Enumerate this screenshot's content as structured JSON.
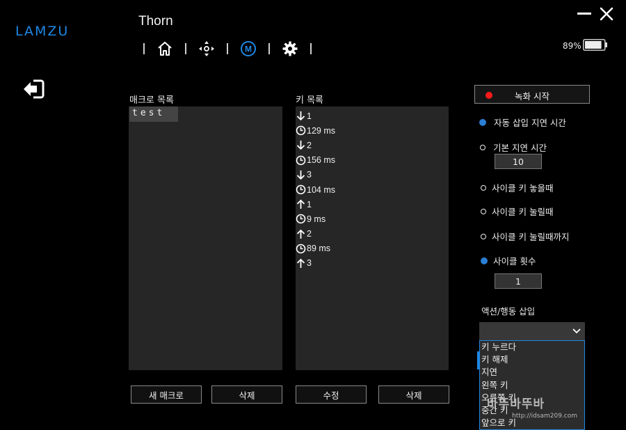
{
  "app": {
    "logo": "LAMZU",
    "device_name": "Thorn",
    "battery_percent": "89%",
    "battery_level": 0.89
  },
  "nav": {
    "items": [
      {
        "icon": "home-icon"
      },
      {
        "icon": "dpad-icon"
      },
      {
        "icon": "macro-icon",
        "text": "M",
        "active": true
      },
      {
        "icon": "gear-icon"
      }
    ]
  },
  "macro_list": {
    "label": "매크로 목록",
    "items": [
      "test"
    ],
    "new_button": "새 매크로",
    "delete_button": "삭제"
  },
  "key_list": {
    "label": "키 목록",
    "rows": [
      {
        "icon": "arrow-down-icon",
        "text": "1"
      },
      {
        "icon": "clock-icon",
        "text": "129 ms"
      },
      {
        "icon": "arrow-down-icon",
        "text": "2"
      },
      {
        "icon": "clock-icon",
        "text": "156 ms"
      },
      {
        "icon": "arrow-down-icon",
        "text": "3"
      },
      {
        "icon": "clock-icon",
        "text": "104 ms"
      },
      {
        "icon": "arrow-up-icon",
        "text": "1"
      },
      {
        "icon": "clock-icon",
        "text": "9 ms"
      },
      {
        "icon": "arrow-up-icon",
        "text": "2"
      },
      {
        "icon": "clock-icon",
        "text": "89 ms"
      },
      {
        "icon": "arrow-up-icon",
        "text": "3"
      }
    ],
    "edit_button": "수정",
    "delete_button": "삭제"
  },
  "options": {
    "record_button": "녹화 시작",
    "auto_delay": "자동 삽입 지연 시간",
    "default_delay": "기본 지연 시간",
    "default_delay_value": "10",
    "cycle_release": "사이클 키 놓을때",
    "cycle_press": "사이클 키 눌릴때",
    "cycle_until_press": "사이클 키 눌릴때까지",
    "cycle_count": "사이클 횟수",
    "cycle_count_value": "1",
    "action_insert_label": "액션/행동 삽입",
    "dropdown_items": [
      "키 누르다",
      "키 해제",
      "지연",
      "왼쪽 키",
      "오른쪽 키",
      "중간 키",
      "앞으로 키"
    ]
  },
  "watermark": {
    "title": "바뚜바뚜바",
    "url": "http://idsam209.com"
  },
  "colors": {
    "accent": "#1e88e5",
    "record": "#ff1a1a",
    "panel": "#262626"
  }
}
